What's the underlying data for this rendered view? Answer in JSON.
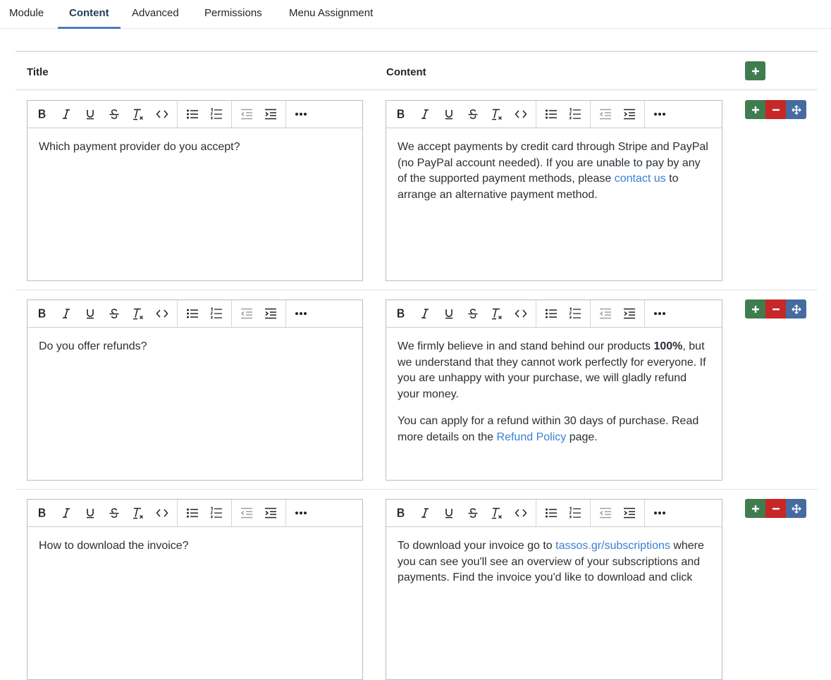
{
  "tabs": [
    {
      "label": "Module"
    },
    {
      "label": "Content"
    },
    {
      "label": "Advanced"
    },
    {
      "label": "Permissions"
    },
    {
      "label": "Menu Assignment"
    }
  ],
  "header": {
    "title_col": "Title",
    "content_col": "Content"
  },
  "colors": {
    "add": "#3f7d4f",
    "remove": "#c52827",
    "move": "#456ba0",
    "link": "#3b7fd4",
    "active_tab": "#4a7bc1"
  },
  "toolbar_icons": [
    "bold-icon",
    "italic-icon",
    "underline-icon",
    "strikethrough-icon",
    "clear-formatting-icon",
    "code-icon",
    "bullet-list-icon",
    "numbered-list-icon",
    "outdent-icon",
    "indent-icon",
    "more-icon"
  ],
  "rows": [
    {
      "title": "Which payment provider do you accept?",
      "content": [
        {
          "p": [
            {
              "t": "We accept payments by credit card through Stripe and PayPal (no PayPal account needed). If you are unable to pay by any of the supported payment methods, please "
            },
            {
              "t": "contact us",
              "link": true
            },
            {
              "t": " to arrange an alternative payment method."
            }
          ]
        }
      ]
    },
    {
      "title": "Do you offer refunds?",
      "content": [
        {
          "p": [
            {
              "t": "We firmly believe in and stand behind our products "
            },
            {
              "t": "100%",
              "bold": true
            },
            {
              "t": ", but we understand that they cannot work perfectly for everyone. If you are unhappy with your purchase, we will gladly refund your money."
            }
          ]
        },
        {
          "p": [
            {
              "t": "You can apply for a refund within 30 days of purchase. Read more details on the "
            },
            {
              "t": "Refund Policy",
              "link": true
            },
            {
              "t": " page."
            }
          ]
        }
      ]
    },
    {
      "title": "How to download the invoice?",
      "content": [
        {
          "p": [
            {
              "t": "To download your invoice go to "
            },
            {
              "t": "tassos.gr/subscriptions",
              "link": true
            },
            {
              "t": " where you can see you'll see an overview of your subscriptions and payments. Find the invoice you'd like to download and click"
            }
          ]
        }
      ]
    }
  ]
}
